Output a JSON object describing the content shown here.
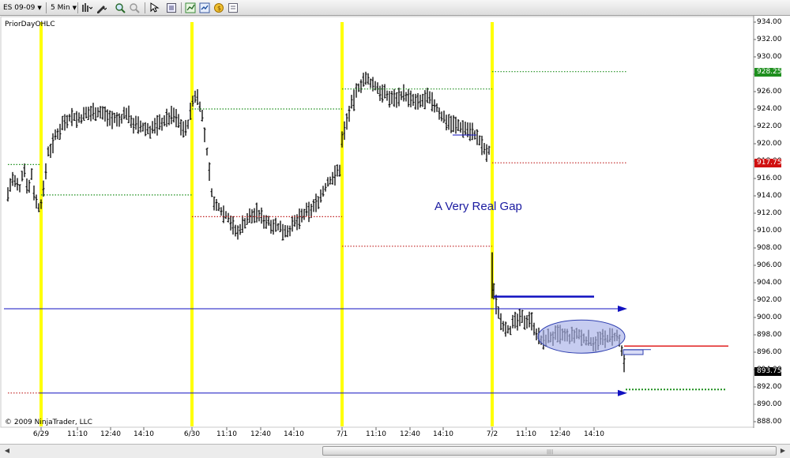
{
  "toolbar": {
    "instrument": "ES 09-09",
    "interval": "5 Min",
    "tools": [
      {
        "name": "bar-type-icon"
      },
      {
        "name": "drawing-tool-icon"
      },
      {
        "name": "zoom-in-icon"
      },
      {
        "name": "zoom-out-icon"
      },
      {
        "name": "cursor-icon"
      },
      {
        "name": "properties-icon"
      },
      {
        "name": "indicators-icon"
      },
      {
        "name": "strategies-icon"
      },
      {
        "name": "coins-icon"
      },
      {
        "name": "data-box-icon"
      }
    ]
  },
  "chart": {
    "indicator_label": "PriorDayOHLC",
    "annotation": "A Very Real Gap",
    "copyright": "© 2009 NinjaTrader, LLC",
    "price_tags": [
      {
        "value": "928.25",
        "color": "#1e8f1e"
      },
      {
        "value": "917.75",
        "color": "#d01010"
      },
      {
        "value": "893.75",
        "color": "#000000"
      }
    ],
    "y_labels": [
      "934.00",
      "932.00",
      "930.00",
      "928.00",
      "926.00",
      "924.00",
      "922.00",
      "920.00",
      "918.00",
      "916.00",
      "914.00",
      "912.00",
      "910.00",
      "908.00",
      "906.00",
      "904.00",
      "902.00",
      "900.00",
      "898.00",
      "896.00",
      "894.00",
      "892.00",
      "890.00",
      "888.00"
    ],
    "x_labels": [
      "6/29",
      "11:10",
      "12:40",
      "14:10",
      "6/30",
      "11:10",
      "12:40",
      "14:10",
      "7/1",
      "11:10",
      "12:40",
      "14:10",
      "7/2",
      "11:10",
      "12:40",
      "14:10"
    ]
  },
  "colors": {
    "session_line": "#ffff00",
    "prior_high": "#1e8f1e",
    "prior_low": "#c02020",
    "trendline": "#1010c0",
    "resistance": "#e02020",
    "range_ellipse": "#a8b0e8"
  },
  "chart_data": {
    "type": "candlestick",
    "instrument": "ES 09-09",
    "interval": "5 Min",
    "ylim": [
      888,
      934
    ],
    "x": [
      "6/29",
      "11:10",
      "12:40",
      "14:10",
      "6/30",
      "11:10",
      "12:40",
      "14:10",
      "7/1",
      "11:10",
      "12:40",
      "14:10",
      "7/2",
      "11:10",
      "12:40",
      "14:10"
    ],
    "price_path": [
      [
        0,
        914.0
      ],
      [
        5,
        915.5
      ],
      [
        10,
        914.2
      ],
      [
        15,
        916.0
      ],
      [
        20,
        915.3
      ],
      [
        25,
        914.8
      ],
      [
        30,
        917.5
      ],
      [
        33,
        916.0
      ],
      [
        36,
        914.5
      ],
      [
        40,
        916.5
      ],
      [
        44,
        914.0
      ],
      [
        48,
        912.5
      ],
      [
        52,
        913.2
      ],
      [
        56,
        915.0
      ],
      [
        60,
        919.0
      ],
      [
        65,
        919.5
      ],
      [
        70,
        920.8
      ],
      [
        75,
        921.5
      ],
      [
        80,
        922.5
      ],
      [
        90,
        923.2
      ],
      [
        100,
        922.8
      ],
      [
        110,
        923.4
      ],
      [
        120,
        923.8
      ],
      [
        130,
        923.5
      ],
      [
        140,
        923.0
      ],
      [
        150,
        922.6
      ],
      [
        160,
        923.6
      ],
      [
        170,
        922.2
      ],
      [
        180,
        921.8
      ],
      [
        190,
        921.6
      ],
      [
        200,
        922.2
      ],
      [
        210,
        922.8
      ],
      [
        220,
        923.3
      ],
      [
        230,
        922.0
      ],
      [
        236,
        921.5
      ],
      [
        243,
        924.5
      ],
      [
        248,
        925.8
      ],
      [
        252,
        925.0
      ],
      [
        256,
        923.0
      ],
      [
        260,
        920.5
      ],
      [
        264,
        917.5
      ],
      [
        268,
        914.5
      ],
      [
        272,
        912.5
      ],
      [
        276,
        913.0
      ],
      [
        280,
        912.3
      ],
      [
        290,
        911.5
      ],
      [
        300,
        909.5
      ],
      [
        305,
        910.5
      ],
      [
        315,
        911.5
      ],
      [
        325,
        912.0
      ],
      [
        335,
        911.2
      ],
      [
        345,
        910.8
      ],
      [
        355,
        910.2
      ],
      [
        365,
        910.0
      ],
      [
        375,
        911.0
      ],
      [
        385,
        911.8
      ],
      [
        395,
        912.5
      ],
      [
        405,
        913.8
      ],
      [
        415,
        915.5
      ],
      [
        425,
        916.5
      ],
      [
        430,
        917.0
      ],
      [
        433,
        920.5
      ],
      [
        438,
        922.3
      ],
      [
        443,
        924.0
      ],
      [
        448,
        925.0
      ],
      [
        452,
        926.2
      ],
      [
        456,
        926.8
      ],
      [
        460,
        927.4
      ],
      [
        470,
        927.0
      ],
      [
        480,
        926.2
      ],
      [
        490,
        925.4
      ],
      [
        500,
        925.2
      ],
      [
        510,
        925.8
      ],
      [
        520,
        925.0
      ],
      [
        530,
        924.6
      ],
      [
        540,
        925.3
      ],
      [
        550,
        924.5
      ],
      [
        560,
        923.0
      ],
      [
        570,
        922.5
      ],
      [
        580,
        922.0
      ],
      [
        590,
        921.8
      ],
      [
        600,
        921.2
      ],
      [
        605,
        920.5
      ],
      [
        612,
        919.5
      ],
      [
        616,
        918.8
      ],
      [
        620,
        919.2
      ],
      [
        623,
        905.5
      ],
      [
        626,
        902.0
      ],
      [
        630,
        901.0
      ],
      [
        635,
        899.4
      ],
      [
        640,
        899.0
      ],
      [
        645,
        898.5
      ],
      [
        650,
        899.3
      ],
      [
        655,
        899.6
      ],
      [
        660,
        899.8
      ],
      [
        665,
        899.6
      ],
      [
        670,
        900.0
      ],
      [
        675,
        899.2
      ],
      [
        680,
        898.0
      ],
      [
        685,
        897.2
      ],
      [
        690,
        897.5
      ],
      [
        700,
        897.8
      ],
      [
        710,
        898.0
      ],
      [
        720,
        897.6
      ],
      [
        730,
        898.0
      ],
      [
        740,
        897.5
      ],
      [
        750,
        897.2
      ],
      [
        760,
        897.4
      ],
      [
        770,
        897.6
      ],
      [
        780,
        897.8
      ],
      [
        785,
        897.0
      ],
      [
        789,
        895.0
      ],
      [
        792,
        893.8
      ]
    ],
    "session_starts": [
      "6/29",
      "6/30",
      "7/1",
      "7/2"
    ],
    "levels": [
      {
        "kind": "prior_high",
        "price": 917.6,
        "from": 10,
        "to": 50
      },
      {
        "kind": "prior_low",
        "price": 891.3,
        "from": 10,
        "to": 50
      },
      {
        "kind": "prior_high",
        "price": 914.1,
        "from": 52,
        "to": 243
      },
      {
        "kind": "prior_high",
        "price": 924.0,
        "from": 243,
        "to": 433
      },
      {
        "kind": "prior_low",
        "price": 911.6,
        "from": 243,
        "to": 433
      },
      {
        "kind": "prior_high",
        "price": 926.3,
        "from": 433,
        "to": 623
      },
      {
        "kind": "prior_low",
        "price": 908.2,
        "from": 433,
        "to": 623
      },
      {
        "kind": "prior_high",
        "price": 928.3,
        "from": 623,
        "to": 793
      },
      {
        "kind": "prior_low",
        "price": 917.8,
        "from": 623,
        "to": 793
      }
    ]
  }
}
